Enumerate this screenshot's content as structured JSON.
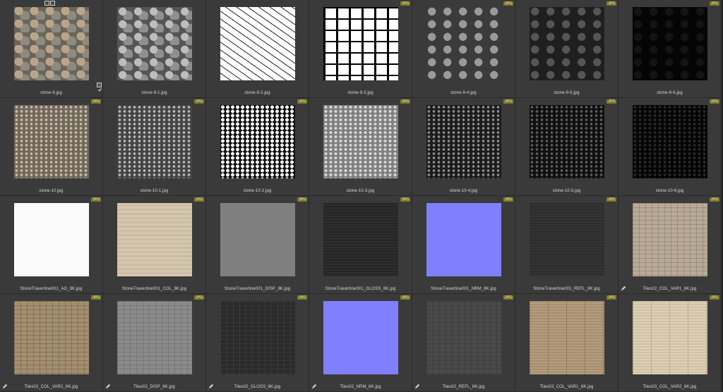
{
  "files": [
    {
      "name": "stone-9.jpg",
      "type": "JPG",
      "style": "stone-color",
      "badge": false,
      "pencil": false
    },
    {
      "name": "stone-9-1.jpg",
      "type": "JPG",
      "style": "stone-gray",
      "badge": false,
      "pencil": false
    },
    {
      "name": "stone-9-2.jpg",
      "type": "JPG",
      "style": "stone-bw-thin",
      "badge": false,
      "pencil": false
    },
    {
      "name": "stone-9-3.jpg",
      "type": "JPG",
      "style": "stone-bw-thick",
      "badge": true,
      "pencil": false
    },
    {
      "name": "stone-9-4.jpg",
      "type": "JPG",
      "style": "stone-darkgray",
      "badge": true,
      "pencil": false
    },
    {
      "name": "stone-9-5.jpg",
      "type": "JPG",
      "style": "stone-dark",
      "badge": true,
      "pencil": false
    },
    {
      "name": "stone-9-6.jpg",
      "type": "JPG",
      "style": "stone-black",
      "badge": true,
      "pencil": false
    },
    {
      "name": "stone-10.jpg",
      "type": "JPG",
      "style": "pebble-color",
      "badge": true,
      "pencil": false
    },
    {
      "name": "stone-10-1.jpg",
      "type": "JPG",
      "style": "pebble-gray",
      "badge": true,
      "pencil": false
    },
    {
      "name": "stone-10-2.jpg",
      "type": "JPG",
      "style": "pebble-bw",
      "badge": true,
      "pencil": false
    },
    {
      "name": "stone-10-3.jpg",
      "type": "JPG",
      "style": "pebble-light",
      "badge": true,
      "pencil": false
    },
    {
      "name": "stone-10-4.jpg",
      "type": "JPG",
      "style": "pebble-darkgray",
      "badge": true,
      "pencil": false
    },
    {
      "name": "stone-10-5.jpg",
      "type": "JPG",
      "style": "pebble-dark",
      "badge": true,
      "pencil": false
    },
    {
      "name": "stone-10-6.jpg",
      "type": "JPG",
      "style": "pebble-black",
      "badge": true,
      "pencil": false
    },
    {
      "name": "StoneTravertine001_AO_8K.jpg",
      "type": "JPG",
      "style": "solid-white",
      "badge": true,
      "pencil": false
    },
    {
      "name": "StoneTravertine001_COL_8K.jpg",
      "type": "JPG",
      "style": "travertine",
      "badge": true,
      "pencil": false
    },
    {
      "name": "StoneTravertine001_DISP_8K.jpg",
      "type": "JPG",
      "style": "solid-midgray",
      "badge": true,
      "pencil": false
    },
    {
      "name": "StoneTravertine001_GLOSS_8K.jpg",
      "type": "JPG",
      "style": "gloss-dark",
      "badge": true,
      "pencil": false
    },
    {
      "name": "StoneTravertine001_NRM_8K.jpg",
      "type": "JPG",
      "style": "normal-blue",
      "badge": true,
      "pencil": false
    },
    {
      "name": "StoneTravertine001_REFL_8K.jpg",
      "type": "JPG",
      "style": "refl-dark",
      "badge": true,
      "pencil": false
    },
    {
      "name": "Tiles02_COL_VAR1_6K.jpg",
      "type": "JPG",
      "style": "tiles-color",
      "badge": true,
      "pencil": true
    },
    {
      "name": "Tiles02_COL_VAR2_6K.jpg",
      "type": "JPG",
      "style": "tiles-warm",
      "badge": true,
      "pencil": true
    },
    {
      "name": "Tiles02_DISP_6K.jpg",
      "type": "JPG",
      "style": "tiles-gray",
      "badge": true,
      "pencil": true
    },
    {
      "name": "Tiles02_GLOSS_6K.jpg",
      "type": "JPG",
      "style": "tiles-dark",
      "badge": true,
      "pencil": true
    },
    {
      "name": "Tiles02_NRM_6K.jpg",
      "type": "JPG",
      "style": "normal-blue",
      "badge": true,
      "pencil": true
    },
    {
      "name": "Tiles02_REFL_6K.jpg",
      "type": "JPG",
      "style": "tiles-refl",
      "badge": true,
      "pencil": true
    },
    {
      "name": "Tiles03_COL_VAR1_6K.jpg",
      "type": "JPG",
      "style": "wood-tiles",
      "badge": true,
      "pencil": false
    },
    {
      "name": "Tiles03_COL_VAR2_6K.jpg",
      "type": "JPG",
      "style": "wood-tiles-light",
      "badge": true,
      "pencil": false
    }
  ],
  "selection": {
    "checked_item": "stone-9.jpg"
  },
  "colors": {
    "panel_bg": "#3a3a3a",
    "badge_bg": "#7d7a2c",
    "text": "#d9d9d9"
  }
}
